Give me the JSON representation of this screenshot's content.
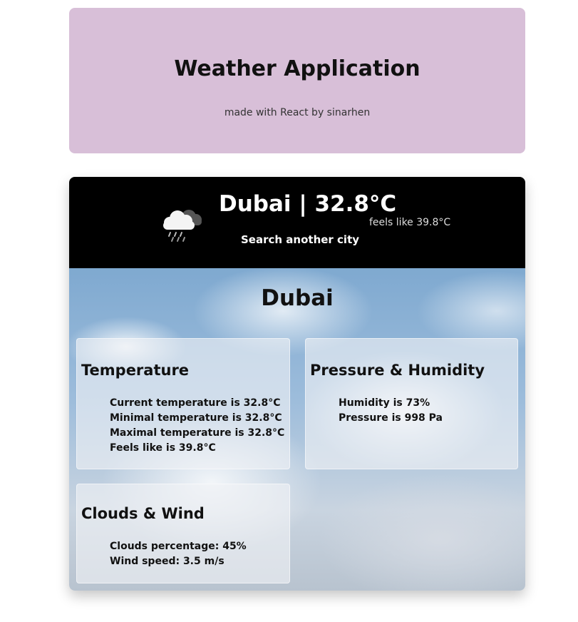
{
  "header": {
    "title": "Weather Application",
    "subtitle": "made with React by sinarhen"
  },
  "summary": {
    "icon": "rain-cloud-icon",
    "city_temp": "Dubai | 32.8°C",
    "feels_like": "feels like 39.8°C",
    "search_label": "Search another city"
  },
  "details": {
    "city": "Dubai",
    "temperature": {
      "title": "Temperature",
      "items": [
        "Current temperature is 32.8°C",
        "Minimal temperature is 32.8°C",
        "Maximal temperature is 32.8°C",
        "Feels like is 39.8°C"
      ]
    },
    "pressure_humidity": {
      "title": "Pressure & Humidity",
      "items": [
        "Humidity is 73%",
        "Pressure is 998 Pa"
      ]
    },
    "clouds_wind": {
      "title": "Clouds & Wind",
      "items": [
        "Clouds percentage: 45%",
        "Wind speed: 3.5 m/s"
      ]
    }
  },
  "colors": {
    "header_bg": "#d8bfd8",
    "top_bar_bg": "#000000",
    "box_bg": "rgba(240,242,246,0.62)"
  }
}
